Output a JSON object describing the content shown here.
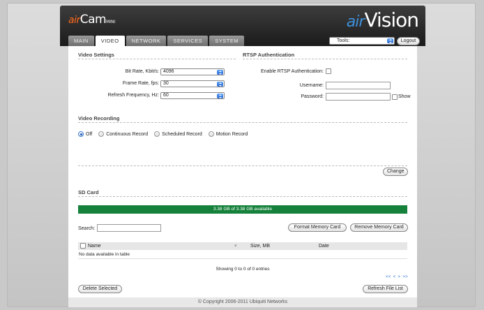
{
  "header": {
    "logo_left": {
      "prefix": "air",
      "main": "Cam",
      "suffix": "MINI"
    },
    "logo_right": {
      "prefix": "air",
      "main": "Vision"
    },
    "tabs": [
      {
        "label": "MAIN",
        "active": false
      },
      {
        "label": "VIDEO",
        "active": true
      },
      {
        "label": "NETWORK",
        "active": false
      },
      {
        "label": "SERVICES",
        "active": false
      },
      {
        "label": "SYSTEM",
        "active": false
      }
    ],
    "tools_select": "Tools:",
    "logout_label": "Logout"
  },
  "video_settings": {
    "title": "Video Settings",
    "bitrate_label": "Bit Rate, Kbit/s:",
    "bitrate_value": "4096",
    "framerate_label": "Frame Rate, fps:",
    "framerate_value": "30",
    "refresh_label": "Refresh Frequency, Hz:",
    "refresh_value": "60"
  },
  "rtsp": {
    "title": "RTSP Authentication",
    "enable_label": "Enable RTSP Authentication:",
    "username_label": "Username:",
    "password_label": "Password:",
    "show_label": "Show"
  },
  "video_recording": {
    "title": "Video Recording",
    "options": [
      "Off",
      "Continuous Record",
      "Scheduled Record",
      "Motion Record"
    ],
    "selected": "Off",
    "change_label": "Change"
  },
  "sd_card": {
    "title": "SD Card",
    "availability": "3.38 GB of 3.38 GB available",
    "availability_fraction": 1.0,
    "bar_color": "#15813a",
    "search_label": "Search:",
    "format_label": "Format Memory Card",
    "remove_label": "Remove Memory Card",
    "columns": [
      "Name",
      "Size, MB",
      "Date"
    ],
    "sort_indicator": "▾",
    "empty_text": "No data available in table",
    "info": "Showing 0 to 0 of 0 entries",
    "pager": [
      "<<",
      "<",
      ">",
      ">>"
    ],
    "delete_label": "Delete Selected",
    "refresh_label": "Refresh File List"
  },
  "footer": {
    "copyright": "© Copyright 2006-2011 Ubiquiti Networks"
  }
}
